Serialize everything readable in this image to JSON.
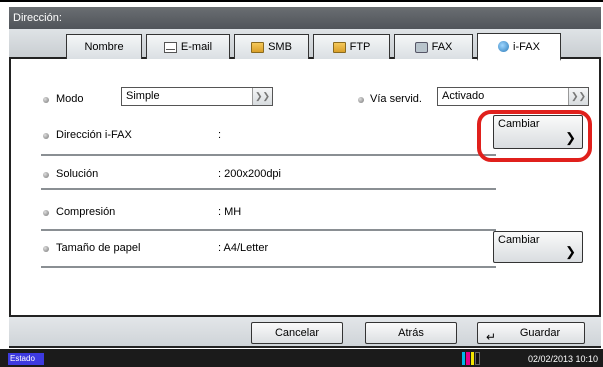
{
  "header": {
    "title": "Dirección:"
  },
  "tabs": [
    {
      "label": "Nombre",
      "icon": ""
    },
    {
      "label": "E-mail",
      "icon": "mail-icon"
    },
    {
      "label": "SMB",
      "icon": "folder-icon"
    },
    {
      "label": "FTP",
      "icon": "folder-icon"
    },
    {
      "label": "FAX",
      "icon": "fax-icon"
    },
    {
      "label": "i-FAX",
      "icon": "ifax-icon",
      "active": true
    }
  ],
  "form": {
    "mode_label": "Modo",
    "mode_value": "Simple",
    "via_label": "Vía servid.",
    "via_value": "Activado",
    "address_label": "Dirección i-FAX",
    "address_sep": ":",
    "change_label": "Cambiar",
    "resolution_label": "Solución",
    "resolution_value": ":  200x200dpi",
    "compression_label": "Compresión",
    "compression_value": ":  MH",
    "paper_label": "Tamaño de papel",
    "paper_value": ":  A4/Letter",
    "change2_label": "Cambiar"
  },
  "footer": {
    "cancel_label": "Cancelar",
    "back_label": "Atrás",
    "save_label": "Guardar"
  },
  "status": {
    "label": "Estado",
    "datetime": "02/02/2013  10:10"
  },
  "colors": {
    "highlight": "#e0201c",
    "status_label_bg": "#3d3ae0"
  }
}
